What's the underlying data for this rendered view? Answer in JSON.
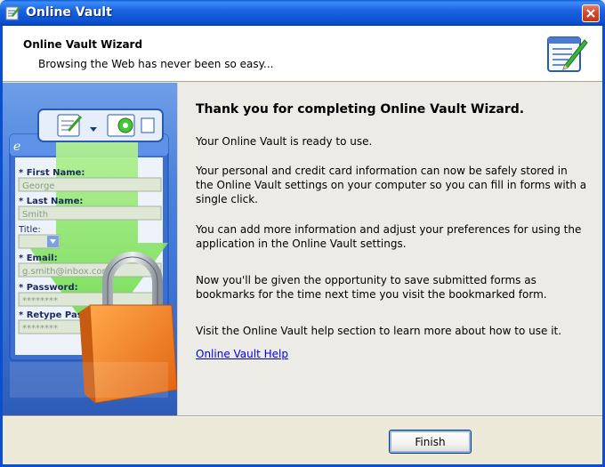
{
  "window": {
    "title": "Online Vault"
  },
  "header": {
    "title": "Online Vault Wizard",
    "subtitle": "Browsing the Web has never been so easy..."
  },
  "banner_form": {
    "first_name_label": "* First Name:",
    "first_name_value": "George",
    "last_name_label": "* Last Name:",
    "last_name_value": "Smith",
    "title_label": "Title:",
    "email_label": "* Email:",
    "email_value": "g.smith@inbox.com",
    "password_label": "* Password:",
    "password_value": "********",
    "retype_label": "* Retype Password:",
    "retype_value": "********"
  },
  "content": {
    "heading": "Thank you for completing Online Vault Wizard.",
    "p1": "Your Online Vault is ready to use.",
    "p2": "Your personal and credit card information can now be safely stored in the Online Vault settings on your computer so you can fill in forms with a single click.",
    "p3": "You can add more information and adjust your preferences for using the application in the Online Vault settings.",
    "p4": "Now you'll be given the opportunity to save submitted forms as bookmarks for the time next time you visit the bookmarked form.",
    "p5": "Visit the Online Vault help section to learn more about how to use it.",
    "help_link": "Online Vault Help"
  },
  "footer": {
    "finish_label": "Finish"
  },
  "colors": {
    "titlebar": "#0a4fd0",
    "banner": "#4b82dd",
    "arrow": "#7de05a",
    "lock": "#f07a1e"
  }
}
